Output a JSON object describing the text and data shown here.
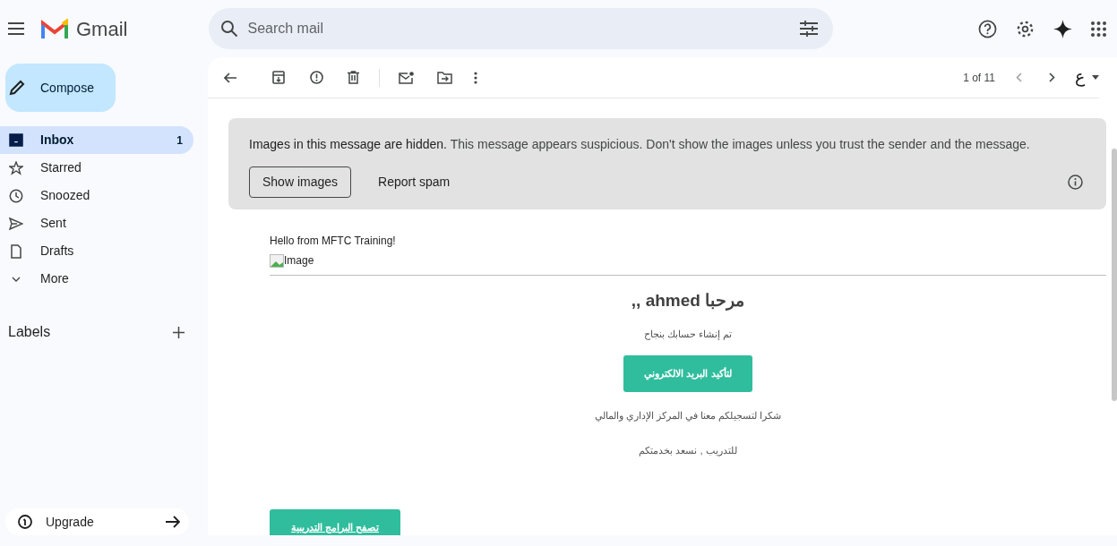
{
  "app": {
    "name": "Gmail"
  },
  "search": {
    "placeholder": "Search mail"
  },
  "compose": {
    "label": "Compose"
  },
  "sidebar": {
    "items": [
      {
        "kind": "inbox",
        "label": "Inbox",
        "count": "1",
        "selected": true
      },
      {
        "kind": "starred",
        "label": "Starred",
        "selected": false
      },
      {
        "kind": "snoozed",
        "label": "Snoozed",
        "selected": false
      },
      {
        "kind": "sent",
        "label": "Sent",
        "selected": false
      },
      {
        "kind": "drafts",
        "label": "Drafts",
        "selected": false
      },
      {
        "kind": "more",
        "label": "More",
        "selected": false
      }
    ],
    "labels_heading": "Labels",
    "upgrade": "Upgrade"
  },
  "toolbar": {
    "pager": "1 of 11",
    "input_tool": "ع"
  },
  "notice": {
    "title": "Images in this message are hidden.",
    "text": "This message appears suspicious. Don't show the images unless you trust the sender and the message.",
    "buttons": [
      "Show images",
      "Report spam"
    ]
  },
  "message": {
    "greeting": "Hello from MFTC Training!",
    "image_alt": "Image",
    "heading": "مرحبا ahmed ,,",
    "line1": "تم إنشاء حسابك بنجاح",
    "confirm_button": "لتأكيد البريد الالكتروني",
    "line2": "شكرا لتسجيلكم معنا في المركز الإداري والمالي",
    "line3": "للتدريب , نسعد بخدمتكم",
    "browse_button": "تصفح البرامج التدريبية"
  }
}
